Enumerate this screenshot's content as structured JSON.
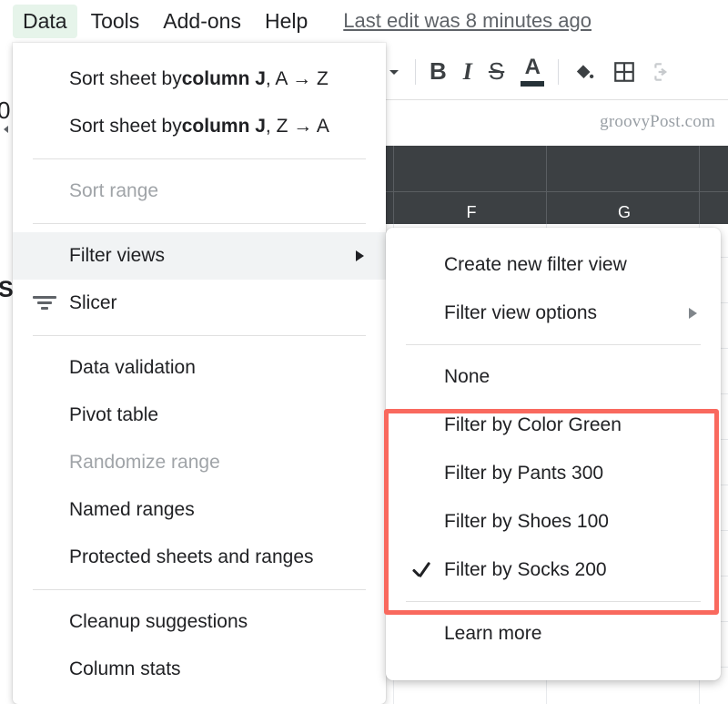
{
  "app": {
    "watermark": "groovyPost.com"
  },
  "menubar": {
    "items": [
      {
        "label": "Data",
        "active": true
      },
      {
        "label": "Tools",
        "active": false
      },
      {
        "label": "Add-ons",
        "active": false
      },
      {
        "label": "Help",
        "active": false
      }
    ],
    "last_edit": "Last edit was 8 minutes ago"
  },
  "toolbar": {
    "dropdown_caret": "caret-down-icon",
    "bold": "B",
    "italic": "I",
    "strikethrough": "S",
    "text_color": "A",
    "fill_color": "paint-bucket-icon",
    "borders": "borders-icon",
    "merge": "merge-cells-icon"
  },
  "spreadsheet": {
    "column_letters": [
      "F",
      "G"
    ],
    "row_label_f": "F",
    "row_label_s": "S",
    "clipped_number": "0"
  },
  "data_menu": {
    "items": [
      {
        "id": "sort-az",
        "label_prefix": "Sort sheet by ",
        "label_bold": "column J",
        "label_suffix": ", A → Z",
        "disabled": false,
        "highlighted": false,
        "submenu": false,
        "icon": null
      },
      {
        "id": "sort-za",
        "label_prefix": "Sort sheet by ",
        "label_bold": "column J",
        "label_suffix": ", Z → A",
        "disabled": false,
        "highlighted": false,
        "submenu": false,
        "icon": null
      },
      {
        "id": "sort-range",
        "label": "Sort range",
        "disabled": true,
        "highlighted": false,
        "submenu": false,
        "icon": null
      },
      {
        "id": "filter-views",
        "label": "Filter views",
        "disabled": false,
        "highlighted": true,
        "submenu": true,
        "icon": null
      },
      {
        "id": "slicer",
        "label": "Slicer",
        "disabled": false,
        "highlighted": false,
        "submenu": false,
        "icon": "slicer-filter-icon"
      },
      {
        "id": "data-validation",
        "label": "Data validation",
        "disabled": false,
        "highlighted": false,
        "submenu": false,
        "icon": null
      },
      {
        "id": "pivot-table",
        "label": "Pivot table",
        "disabled": false,
        "highlighted": false,
        "submenu": false,
        "icon": null
      },
      {
        "id": "randomize-range",
        "label": "Randomize range",
        "disabled": true,
        "highlighted": false,
        "submenu": false,
        "icon": null
      },
      {
        "id": "named-ranges",
        "label": "Named ranges",
        "disabled": false,
        "highlighted": false,
        "submenu": false,
        "icon": null
      },
      {
        "id": "protected-sheets",
        "label": "Protected sheets and ranges",
        "disabled": false,
        "highlighted": false,
        "submenu": false,
        "icon": null
      },
      {
        "id": "cleanup",
        "label": "Cleanup suggestions",
        "disabled": false,
        "highlighted": false,
        "submenu": false,
        "icon": null
      },
      {
        "id": "column-stats",
        "label": "Column stats",
        "disabled": false,
        "highlighted": false,
        "submenu": false,
        "icon": null
      }
    ]
  },
  "filter_views_submenu": {
    "items": [
      {
        "id": "create-new",
        "label": "Create new filter view",
        "submenu": false,
        "checked": false
      },
      {
        "id": "view-options",
        "label": "Filter view options",
        "submenu": true,
        "checked": false
      },
      {
        "id": "none",
        "label": "None",
        "submenu": false,
        "checked": false
      },
      {
        "id": "color-green",
        "label": "Filter by Color Green",
        "submenu": false,
        "checked": false
      },
      {
        "id": "pants-300",
        "label": "Filter by Pants 300",
        "submenu": false,
        "checked": false
      },
      {
        "id": "shoes-100",
        "label": "Filter by Shoes 100",
        "submenu": false,
        "checked": false
      },
      {
        "id": "socks-200",
        "label": "Filter by Socks 200",
        "submenu": false,
        "checked": true
      },
      {
        "id": "learn-more",
        "label": "Learn more",
        "submenu": false,
        "checked": false
      }
    ]
  },
  "annotation": {
    "color": "#f9695e",
    "highlights": [
      "Filter by Color Green",
      "Filter by Pants 300",
      "Filter by Shoes 100",
      "Filter by Socks 200"
    ]
  }
}
